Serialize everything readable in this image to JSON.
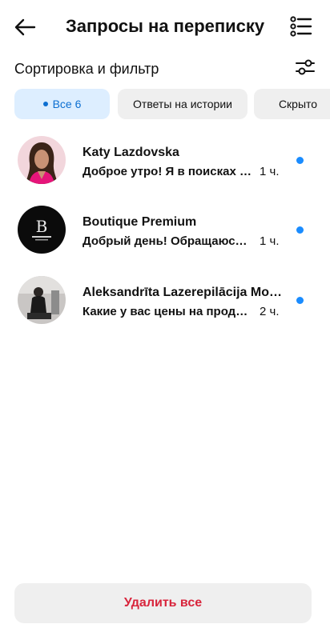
{
  "header": {
    "title": "Запросы на переписку",
    "back_icon": "arrow-left-icon",
    "menu_icon": "list-icon"
  },
  "sort": {
    "label": "Сортировка и фильтр",
    "icon": "sliders-icon"
  },
  "tabs": [
    {
      "label": "Все 6",
      "active": true
    },
    {
      "label": "Ответы на истории",
      "active": false
    },
    {
      "label": "Скрыто",
      "active": false
    }
  ],
  "threads": [
    {
      "name": "Katy Lazdovska",
      "preview": "Доброе утро!  Я в поисках …",
      "time": "1 ч.",
      "unread": true
    },
    {
      "name": "Boutique Premium",
      "preview": "Добрый день! Обращаюсь…",
      "time": "1 ч.",
      "unread": true
    },
    {
      "name": "Aleksandrīta Lazerepilācija Mot...",
      "preview": "Какие у вас цены на продв…",
      "time": "2 ч.",
      "unread": true
    }
  ],
  "delete_all": "Удалить все",
  "colors": {
    "accent": "#1a8cff",
    "danger": "#d8253c"
  }
}
